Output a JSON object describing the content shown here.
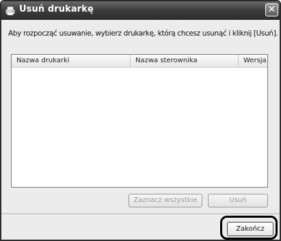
{
  "window": {
    "title": "Usuń drukarkę",
    "close_symbol": "✕"
  },
  "instruction": "Aby rozpocząć usuwanie, wybierz drukarkę, którą chcesz usunąć i kliknij [Usuń].",
  "list": {
    "columns": [
      "Nazwa drukarki",
      "Nazwa sterownika",
      "Wersja"
    ],
    "rows": []
  },
  "buttons": {
    "select_all": "Zaznacz wszystkie",
    "remove": "Usuń",
    "finish": "Zakończ"
  },
  "icons": {
    "title": "printer-icon",
    "close": "close-icon"
  }
}
